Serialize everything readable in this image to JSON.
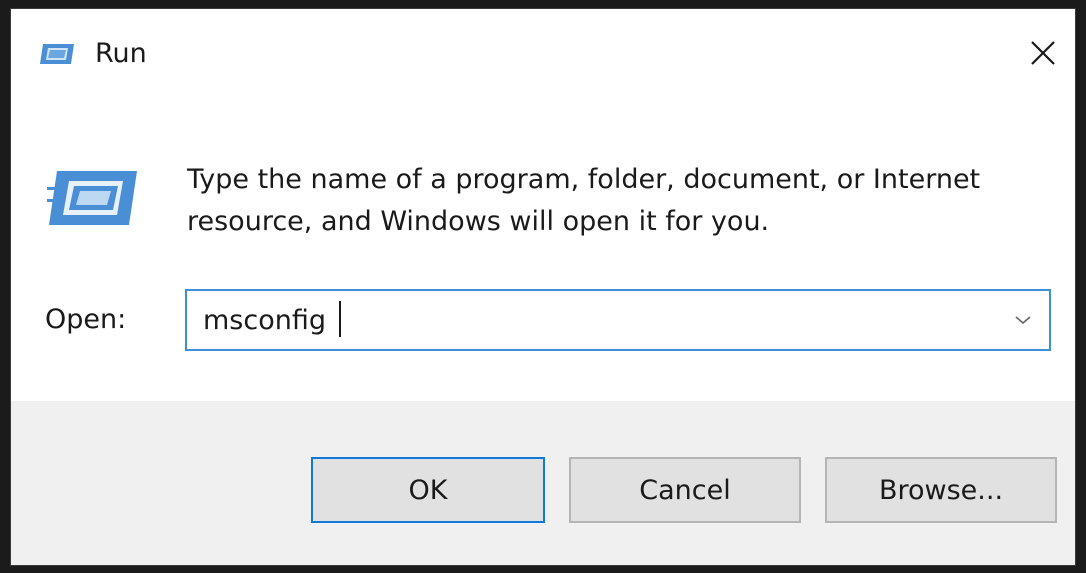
{
  "window": {
    "title": "Run",
    "title_icon": "run-icon",
    "close_icon": "close-icon"
  },
  "content": {
    "icon": "run-icon",
    "description": "Type the name of a program, folder, document, or Internet resource, and Windows will open it for you.",
    "open_label": "Open:",
    "open_value": "msconfig",
    "dropdown_icon": "chevron-down-icon"
  },
  "buttons": {
    "ok": "OK",
    "cancel": "Cancel",
    "browse": "Browse..."
  },
  "colors": {
    "accent": "#0f7ad8",
    "footer_bg": "#f0f0f0",
    "button_bg": "#e1e1e1",
    "icon_blue": "#4a8fd6"
  }
}
